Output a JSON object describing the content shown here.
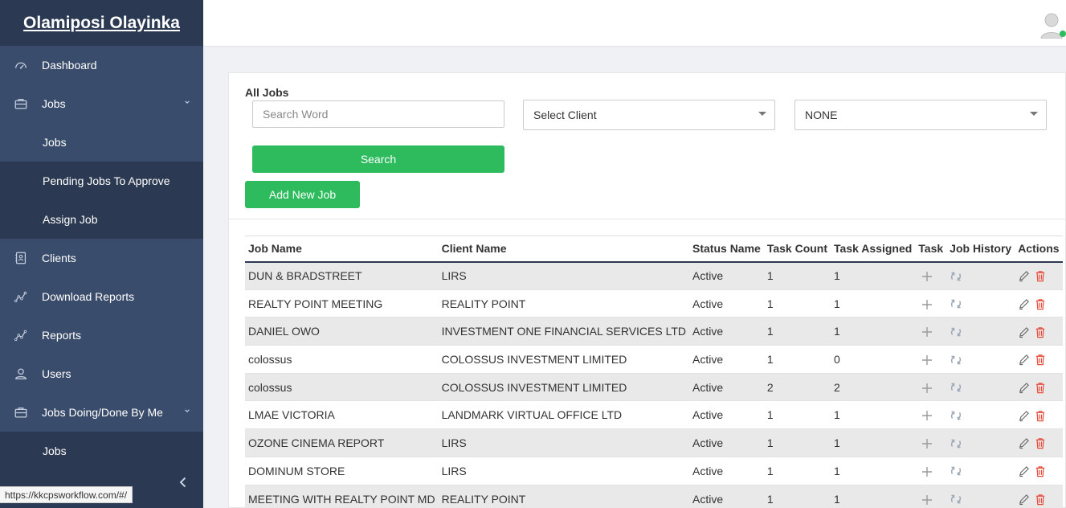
{
  "brand": {
    "name": "Olamiposi Olayinka"
  },
  "sidebar": {
    "items": [
      {
        "label": "Dashboard",
        "icon": "dashboard-icon"
      },
      {
        "label": "Jobs",
        "icon": "briefcase-icon",
        "expanded": true
      },
      {
        "label": "Jobs",
        "sub": true,
        "active": true
      },
      {
        "label": "Pending Jobs To Approve",
        "sub": true
      },
      {
        "label": "Assign Job",
        "sub": true
      },
      {
        "label": "Clients",
        "icon": "contacts-icon"
      },
      {
        "label": "Download Reports",
        "icon": "chart-line-icon"
      },
      {
        "label": "Reports",
        "icon": "chart-line-icon"
      },
      {
        "label": "Users",
        "icon": "users-icon"
      },
      {
        "label": "Jobs Doing/Done By Me",
        "icon": "briefcase-icon",
        "expanded": true
      },
      {
        "label": "Jobs",
        "sub": true
      }
    ]
  },
  "filters": {
    "title": "All Jobs",
    "search_placeholder": "Search Word",
    "client_select": "Select Client",
    "status_select": "NONE",
    "search_button": "Search",
    "add_button": "Add New Job"
  },
  "table": {
    "headers": [
      "Job Name",
      "Client Name",
      "Status Name",
      "Task Count",
      "Task Assigned",
      "Task",
      "Job History",
      "Actions"
    ],
    "rows": [
      {
        "job": "DUN & BRADSTREET",
        "client": "LIRS",
        "status": "Active",
        "count": "1",
        "assigned": "1"
      },
      {
        "job": "REALTY POINT MEETING",
        "client": "REALITY POINT",
        "status": "Active",
        "count": "1",
        "assigned": "1"
      },
      {
        "job": "DANIEL OWO",
        "client": "INVESTMENT ONE FINANCIAL SERVICES LTD",
        "status": "Active",
        "count": "1",
        "assigned": "1"
      },
      {
        "job": "colossus",
        "client": "COLOSSUS INVESTMENT LIMITED",
        "status": "Active",
        "count": "1",
        "assigned": "0"
      },
      {
        "job": "colossus",
        "client": "COLOSSUS INVESTMENT LIMITED",
        "status": "Active",
        "count": "2",
        "assigned": "2"
      },
      {
        "job": "LMAE VICTORIA",
        "client": "LANDMARK VIRTUAL OFFICE LTD",
        "status": "Active",
        "count": "1",
        "assigned": "1"
      },
      {
        "job": "OZONE CINEMA REPORT",
        "client": "LIRS",
        "status": "Active",
        "count": "1",
        "assigned": "1"
      },
      {
        "job": "DOMINUM STORE",
        "client": "LIRS",
        "status": "Active",
        "count": "1",
        "assigned": "1"
      },
      {
        "job": "MEETING WITH REALTY POINT MD",
        "client": "REALITY POINT",
        "status": "Active",
        "count": "1",
        "assigned": "1"
      }
    ]
  },
  "statusbar": {
    "url": "https://kkcpsworkflow.com/#/"
  },
  "colors": {
    "sidebar": "#2b3a52",
    "sidebar_active": "#3a4c6b",
    "accent": "#2dbb5d",
    "delete": "#e74c3c"
  }
}
